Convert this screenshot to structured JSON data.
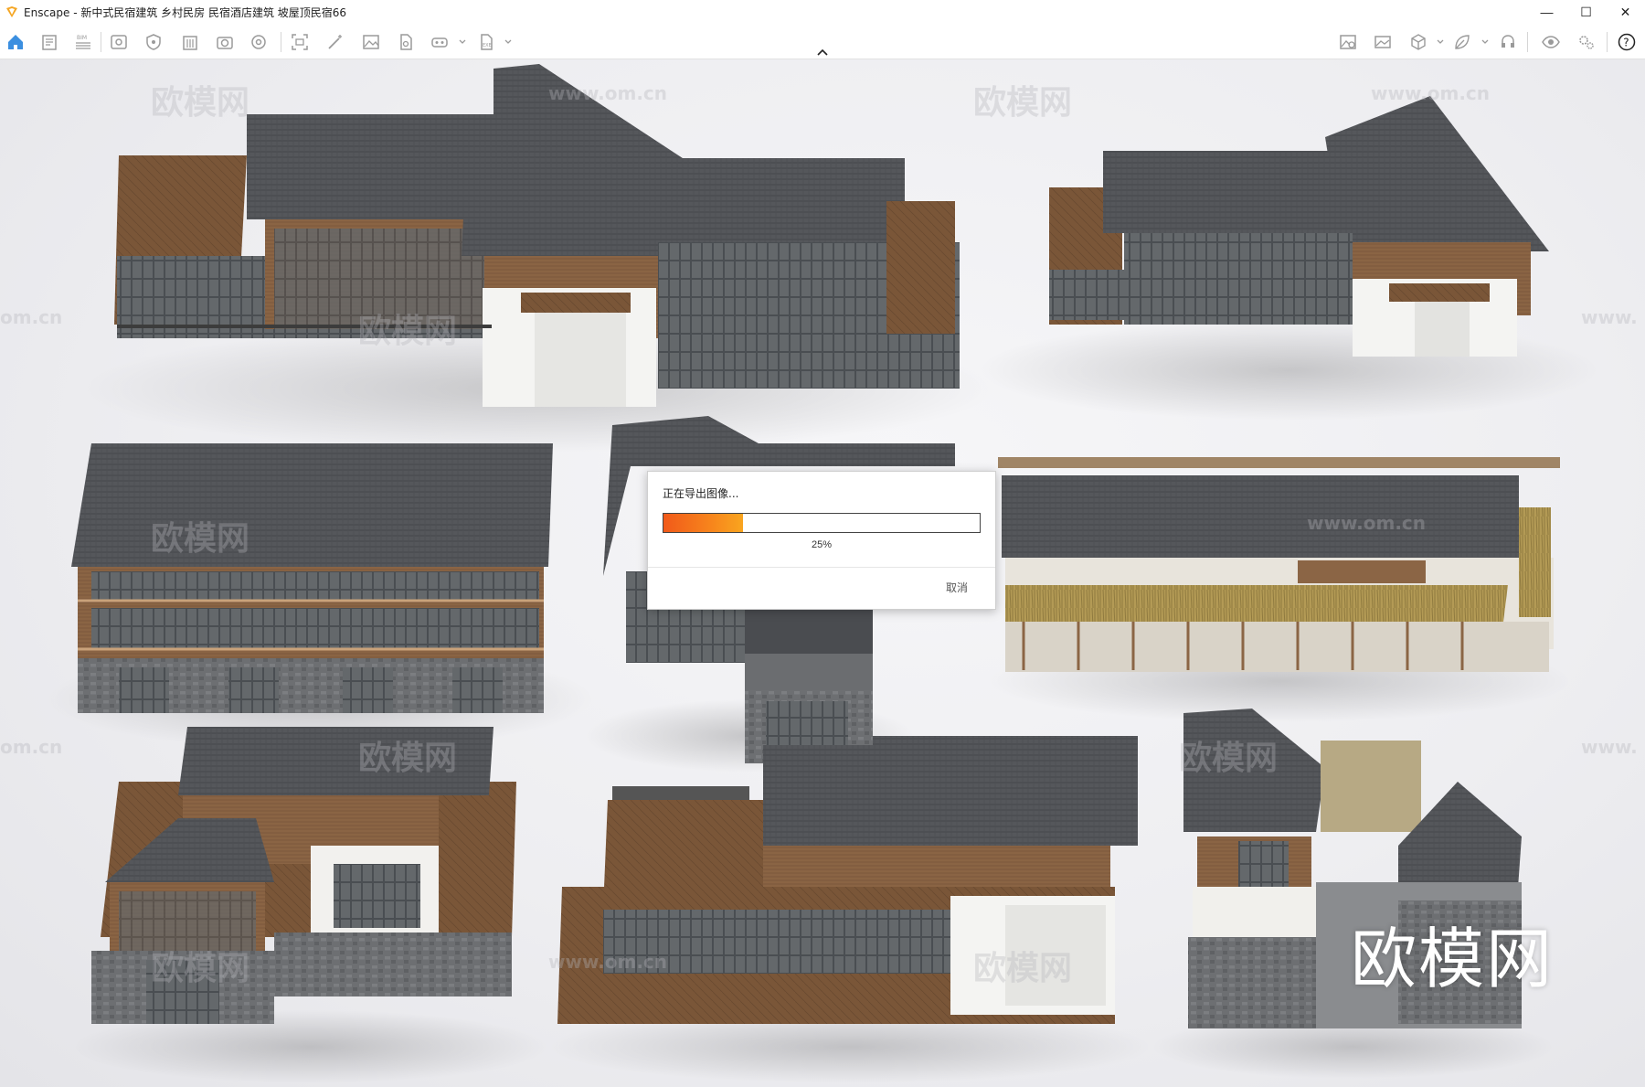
{
  "window": {
    "title": "Enscape - 新中式民宿建筑 乡村民房 民宿酒店建筑 坡屋顶民宿66",
    "controls": [
      "—",
      "☐",
      "✕"
    ]
  },
  "toolbar": {
    "left_icons": [
      "home-icon",
      "notes-icon",
      "bim-icon",
      "view-icon",
      "shield-icon",
      "building-icon",
      "camera-add-icon",
      "settings-wheel-icon",
      "screenshot-icon",
      "magic-wand-icon",
      "image-icon",
      "asset-icon",
      "vr-export-icon",
      "export-icon"
    ],
    "right_icons": [
      "image-settings-icon",
      "panorama-icon",
      "cube-icon",
      "leaf-icon",
      "headset-icon",
      "eye-icon",
      "gear-icon",
      "help-icon"
    ],
    "accent": "#3b8fe0"
  },
  "dialog": {
    "title": "正在导出图像...",
    "progress": 0.25,
    "percent_label": "25%",
    "cancel_label": "取消"
  },
  "watermarks": {
    "brand_cn": "欧模网",
    "url": "www.om.cn",
    "url_fragment": "om.cn",
    "url_fragment_right": "www."
  }
}
